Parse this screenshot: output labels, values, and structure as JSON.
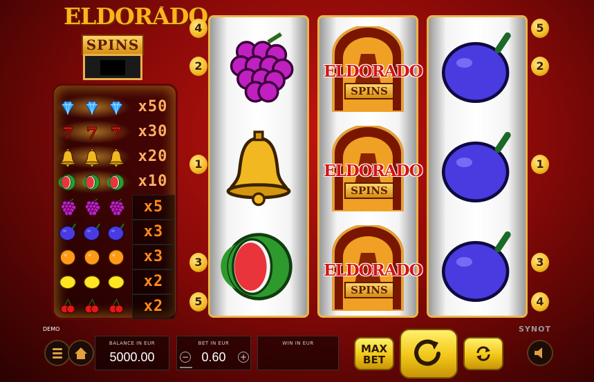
{
  "logo": {
    "line1": "ELDORADO",
    "tm": "™",
    "line2": "SPINS"
  },
  "paytable": [
    {
      "icon": "diamond-icon",
      "mult": "x50"
    },
    {
      "icon": "seven-icon",
      "mult": "x30"
    },
    {
      "icon": "bell-icon",
      "mult": "x20"
    },
    {
      "icon": "watermelon-icon",
      "mult": "x10"
    },
    {
      "icon": "grapes-icon",
      "mult": "x5"
    },
    {
      "icon": "plum-icon",
      "mult": "x3"
    },
    {
      "icon": "orange-icon",
      "mult": "x3"
    },
    {
      "icon": "lemon-icon",
      "mult": "x2"
    },
    {
      "icon": "cherries-icon",
      "mult": "x2"
    }
  ],
  "reels": [
    [
      "grapes",
      "bell",
      "watermelon"
    ],
    [
      "eldorado",
      "eldorado",
      "eldorado"
    ],
    [
      "plum",
      "plum",
      "plum"
    ]
  ],
  "symbol_text": {
    "eldorado_top": "ELDORADO",
    "eldorado_bottom": "SPINS"
  },
  "lines_left": [
    "4",
    "2",
    "1",
    "3",
    "5"
  ],
  "lines_right": [
    "5",
    "2",
    "1",
    "3",
    "4"
  ],
  "demo_label": "DEMO",
  "brand": "SYNOT",
  "balance": {
    "label": "BALANCE IN EUR",
    "value": "5000.00"
  },
  "bet": {
    "label": "BET IN EUR",
    "value": "0.60",
    "minus": "−",
    "plus": "+"
  },
  "win": {
    "label": "WIN IN EUR",
    "value": ""
  },
  "maxbet": {
    "line1": "MAX",
    "line2": "BET"
  },
  "colors": {
    "accent": "#f2c618",
    "background": "#a00f0b",
    "multiplier": "#ff8a1a"
  }
}
